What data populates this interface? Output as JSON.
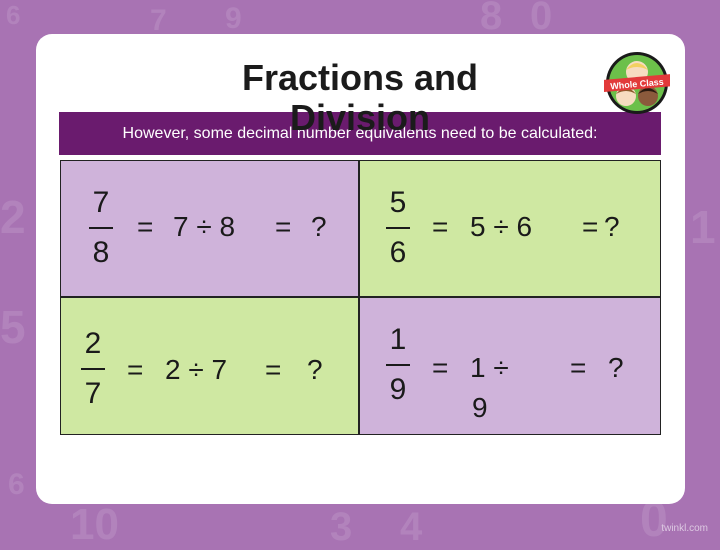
{
  "slide": {
    "title": "Fractions and Division",
    "banner_text": "However, some decimal number equivalents need to be calculated:",
    "badge_label": "Whole Class",
    "footer": "twinkl.com"
  },
  "background_digits": [
    "6",
    "7",
    "9",
    "8",
    "0",
    "2",
    "5",
    "1",
    "10",
    "4",
    "6",
    "3",
    "0"
  ],
  "problems": [
    {
      "numerator": "7",
      "denominator": "8",
      "eq1": "=",
      "expr": "7 ÷ 8",
      "eq2": "=",
      "answer": "?",
      "color": "#cfb3da"
    },
    {
      "numerator": "5",
      "denominator": "6",
      "eq1": "=",
      "expr": "5 ÷ 6",
      "eq2": "=",
      "answer": "?",
      "color": "#cfe8a2"
    },
    {
      "numerator": "2",
      "denominator": "7",
      "eq1": "=",
      "expr": "2 ÷ 7",
      "eq2": "=",
      "answer": "?",
      "color": "#cfe8a2"
    },
    {
      "numerator": "1",
      "denominator": "9",
      "eq1": "=",
      "expr": "1 ÷",
      "expr_wrap": "9",
      "eq2": "=",
      "answer": "?",
      "color": "#cfb3da"
    }
  ],
  "colors": {
    "background": "#a873b3",
    "banner": "#6a1b6e",
    "cell_purple": "#cfb3da",
    "cell_green": "#cfe8a2"
  }
}
